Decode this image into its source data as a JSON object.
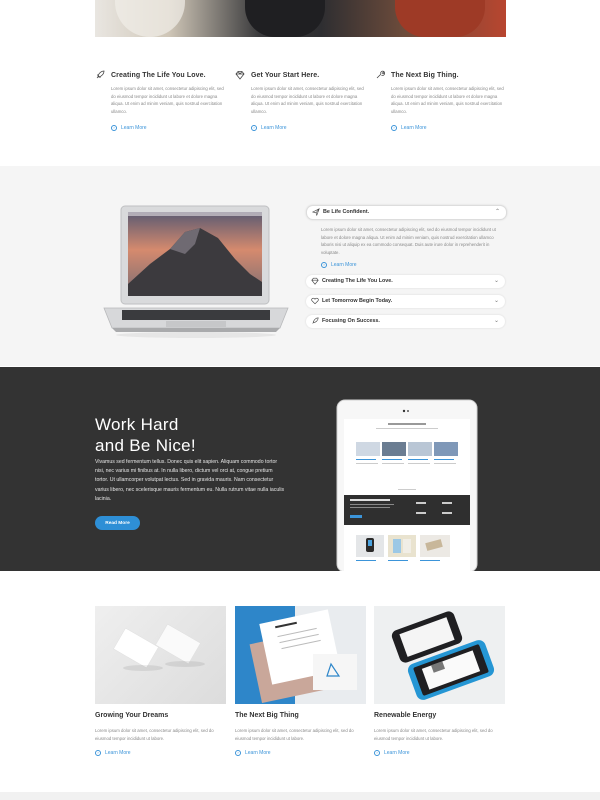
{
  "features": [
    {
      "title": "Creating The Life You Love.",
      "icon": "rocket-icon",
      "body": "Lorem ipsum dolor sit amet, consectetur adipiscing elit, sed do eiusmod tempor incididunt ut labore et dolore magna aliqua. Ut enim ad minim veniam, quis nostrud exercitation ullamco.",
      "link": "Learn More"
    },
    {
      "title": "Get Your Start Here.",
      "icon": "diamond-icon",
      "body": "Lorem ipsum dolor sit amet, consectetur adipiscing elit, sed do eiusmod tempor incididunt ut labore et dolore magna aliqua. Ut enim ad minim veniam, quis nostrud exercitation ullamco.",
      "link": "Learn More"
    },
    {
      "title": "The Next Big Thing.",
      "icon": "wrench-icon",
      "body": "Lorem ipsum dolor sit amet, consectetur adipiscing elit, sed do eiusmod tempor incididunt ut labore et dolore magna aliqua. Ut enim ad minim veniam, quis nostrud exercitation ullamco.",
      "link": "Learn More"
    }
  ],
  "accordion": {
    "open": {
      "label": "Be Life Confident.",
      "icon": "paper-plane-icon",
      "body": "Lorem ipsum dolor sit amet, consectetur adipiscing elit, sed do eiusmod tempor incididunt ut labore et dolore magna aliqua. Ut enim ad minim veniam, quis nostrud exercitation ullamco laboris nisi ut aliquip ex ea commodo consequat. Duis aute irure dolor in reprehenderit in voluptate.",
      "link": "Learn More"
    },
    "items": [
      {
        "label": "Creating The Life You Love.",
        "icon": "diamond-icon"
      },
      {
        "label": "Let Tomorrow Begin Today.",
        "icon": "heart-icon"
      },
      {
        "label": "Focusing On Success.",
        "icon": "rocket-icon"
      }
    ]
  },
  "promo": {
    "heading_line1": "Work Hard",
    "heading_line2": "and Be Nice!",
    "body": "Vivamus sed fermentum tellus. Donec quis elit sapien. Aliquam commodo tortor nisi, nec varius mi finibus at. In nulla libero, dictum vel orci at, congue pretium tortor. Ut ullamcorper volutpat lectus. Sed in gravida mauris. Nam consectetur varius libero, nec scelerisque mauris fermentum eu. Nulla rutrum vitae nulla iaculis lacinia.",
    "button": "Read More"
  },
  "cards": [
    {
      "title": "Growing Your Dreams",
      "body": "Lorem ipsum dolor sit amet, consectetur adipiscing elit, sed do eiusmod tempor incididunt ut labore.",
      "link": "Learn More"
    },
    {
      "title": "The Next Big Thing",
      "body": "Lorem ipsum dolor sit amet, consectetur adipiscing elit, sed do eiusmod tempor incididunt ut labore.",
      "link": "Learn More"
    },
    {
      "title": "Renewable Energy",
      "body": "Lorem ipsum dolor sit amet, consectetur adipiscing elit, sed do eiusmod tempor incididunt ut labore.",
      "link": "Learn More"
    }
  ],
  "colors": {
    "accent": "#3b94d9",
    "dark_bg": "#333333",
    "grey_bg": "#f5f5f5"
  }
}
